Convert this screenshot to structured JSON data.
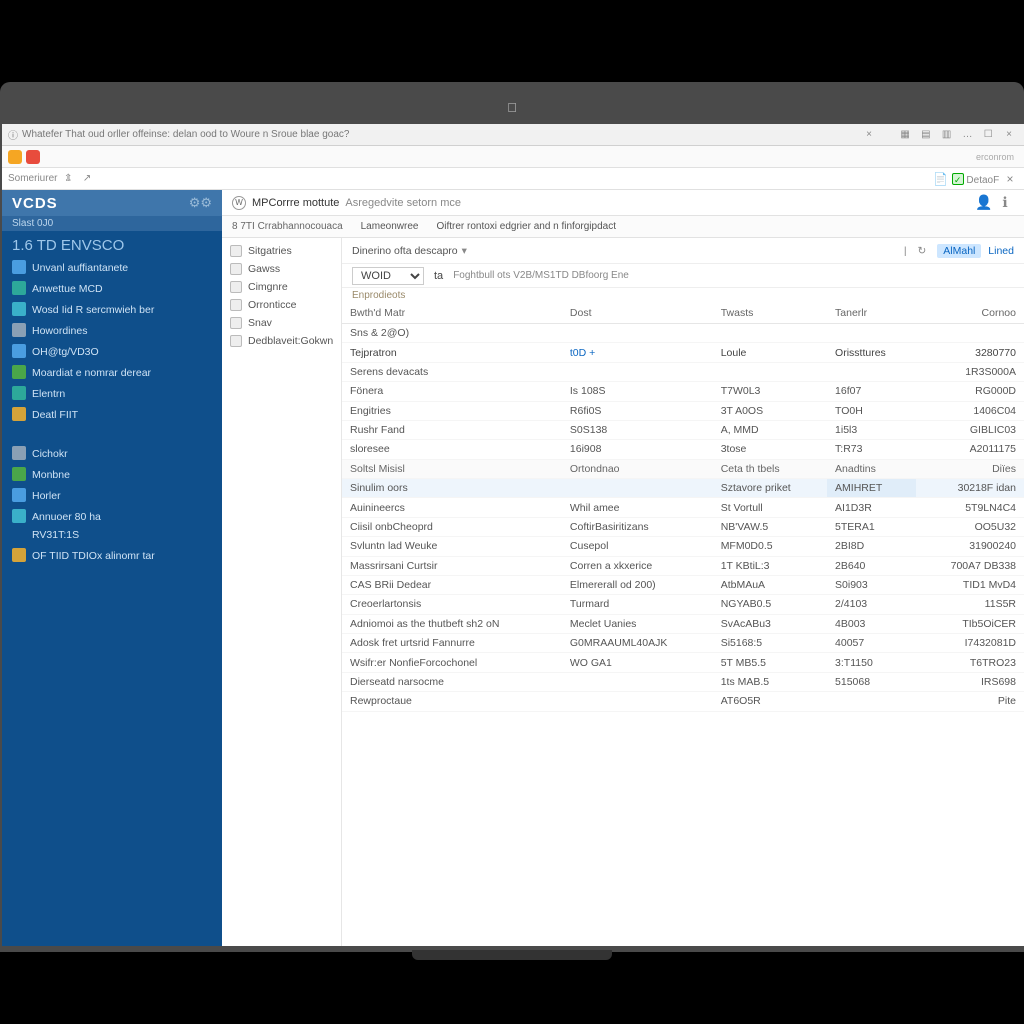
{
  "browser": {
    "tab_title": "Whatefer That oud orller offeinse: delan ood to Woure n Sroue blae goac?",
    "toolbar_label": "Someriurer",
    "detail_label": "DetaoF"
  },
  "sidebar": {
    "brand": "VCDS",
    "subhead": "Slast 0J0",
    "section": "1.6 TD  ENVSCO",
    "items1": [
      "Unvanl auffiantanete",
      "Anwettue MCD",
      "Wosd Iid R sercmwieh ber",
      "Howordines",
      "OH@tg/VD3O",
      "Moardiat e nomrar derear",
      "Elentrn",
      "Deatl FIIT"
    ],
    "items2": [
      "Cichokr",
      "Monbne",
      "Horler",
      "Annuoer 80 ha",
      "RV31T:1S",
      "OF TIID TDIOx alinomr tar"
    ]
  },
  "header": {
    "crumb1": "MPCorrre mottute",
    "crumb2": "Asregedvite setorn mce",
    "tab_lead": "8 7TI Crrabhannocouaca",
    "tab_a": "Lameonwree",
    "tab_b": "Oiftrer rontoxi edgrier and n finforgipdact"
  },
  "subnav": {
    "items": [
      "Sitgatries",
      "Gawss",
      "Cimgnre",
      "Orronticce",
      "Snav",
      "Dedblaveit:Gokwn"
    ]
  },
  "filter": {
    "dropdown": "Dinerino ofta descapro",
    "link_a": "AlMahl",
    "link_b": "Lined"
  },
  "selector": {
    "value": "WOID",
    "prefix": "ta",
    "hint": "Foghtbull ots V2B/MS1TD DBfoorg Ene"
  },
  "minilabel": "Enprodieots",
  "table": {
    "head": [
      "Bwth'd Matr",
      "Dost",
      "Twasts",
      "Tanerlr",
      "Cornoo"
    ],
    "rows": [
      {
        "c": [
          "Sns & 2@O)",
          "",
          "",
          "",
          ""
        ],
        "r": "",
        "cls": ""
      },
      {
        "c": [
          "Tejpratron",
          "t0D +",
          "Loule",
          "Orissttures",
          "3280770"
        ],
        "r": "",
        "cls": "hdr",
        "link": 1
      },
      {
        "c": [
          "Serens devacats",
          "",
          "",
          "",
          "1R3S000A"
        ],
        "r": ""
      },
      {
        "c": [
          "Fönera",
          "Is 108S",
          "T7W0L3",
          "16f07",
          "RG000D"
        ],
        "r": ""
      },
      {
        "c": [
          "Engitries",
          "R6fi0S",
          "3T A0OS",
          "TO0H",
          "1406C04"
        ],
        "r": ""
      },
      {
        "c": [
          "Rushr Fand",
          "S0S138",
          "A, MMD",
          "1i5l3",
          "GIBLIC03"
        ],
        "r": ""
      },
      {
        "c": [
          "sloresee",
          "16i908",
          "3tose",
          "T:R73",
          "A2011175"
        ],
        "r": ""
      }
    ],
    "subhdr": {
      "c": [
        "Soltsl Misisl",
        "Ortondnao",
        "Ceta th tbels",
        "Anadtins",
        "Diïes"
      ]
    },
    "rows2": [
      {
        "c": [
          "Sinulim oors",
          "",
          "Sztavore priket",
          "AMIHRET",
          "30218F idan"
        ],
        "cls": "hl"
      },
      {
        "c": [
          "Auinineercs",
          "Whil amee",
          "St Vortull",
          "AI1D3R",
          "5T9LN4C4"
        ],
        "r": ""
      },
      {
        "c": [
          "Ciisil onbCheoprd",
          "CoftirBasiritizans",
          "NB'VAW.5",
          "5TERA1",
          "OO5U32"
        ],
        "r": ""
      },
      {
        "c": [
          "Svluntn lad Weuke",
          "Cusepol",
          "MFM0D0.5",
          "2BI8D",
          "31900240"
        ],
        "r": ""
      },
      {
        "c": [
          "Massrirsani Curtsir",
          "Corren a xkxerice",
          "1T KBtiL:3",
          "2B640",
          "700A7 DB338"
        ],
        "r": ""
      },
      {
        "c": [
          "CAS BRii Dedear",
          "Elmererall od 200)",
          "AtbMAuA",
          "S0i903",
          "TID1 MvD4"
        ],
        "r": ""
      },
      {
        "c": [
          "Creoerlartonsis",
          "Turmard",
          "NGYAB0.5",
          "2/4103",
          "11S5R"
        ],
        "r": ""
      },
      {
        "c": [
          "Adniomoi as the thutbeft sh2 oN",
          "Meclet Uanies",
          "SvAcABu3",
          "4B003",
          "TIb5OiCER"
        ],
        "r": ""
      },
      {
        "c": [
          "Adosk fret urtsrid Fannurre",
          "G0MRAAUML40AJK",
          "Si5168:5",
          "40057",
          "I7432081D"
        ],
        "r": ""
      },
      {
        "c": [
          "Wsifr:er NonfieForcochonel",
          "WO GA1",
          "5T MB5.5",
          "3:T1150",
          "T6TRO23"
        ],
        "r": ""
      },
      {
        "c": [
          "Dierseatd narsocme",
          "",
          "1ts MAB.5",
          "515068",
          "IRS698"
        ],
        "r": ""
      },
      {
        "c": [
          "Rewproctaue",
          "",
          "AT6O5R",
          "",
          "Pite"
        ],
        "r": ""
      }
    ],
    "rightcap": "erconrom"
  }
}
